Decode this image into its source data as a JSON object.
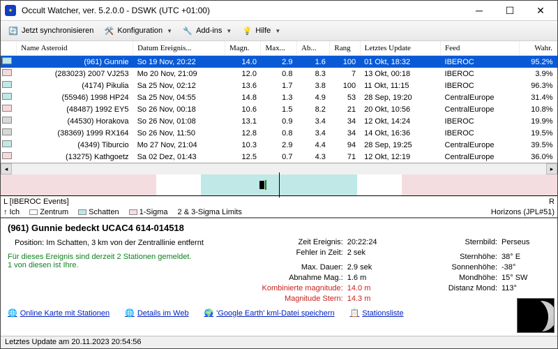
{
  "title": "Occult Watcher, ver. 5.2.0.0 - DSWK (UTC +01:00)",
  "toolbar": {
    "sync": "Jetzt synchronisieren",
    "config": "Konfiguration",
    "addins": "Add-ins",
    "help": "Hilfe"
  },
  "columns": {
    "name": "Name Asteroid",
    "date": "Datum Ereignis...",
    "magn": "Magn.",
    "max": "Max...",
    "ab": "Ab...",
    "rang": "Rang",
    "last": "Letztes Update",
    "feed": "Feed",
    "wahr": "Wahr."
  },
  "rows": [
    {
      "color": "#bfe8e6",
      "name": "(961) Gunnie",
      "date": "So 19 Nov, 20:22",
      "magn": "14.0",
      "max": "2.9",
      "ab": "1.6",
      "rang": "100",
      "last": "01 Okt, 18:32",
      "feed": "IBEROC",
      "wahr": "95.2%",
      "sel": true
    },
    {
      "color": "#f8d8dc",
      "name": "(283023) 2007 VJ253",
      "date": "Mo 20 Nov, 21:09",
      "magn": "12.0",
      "max": "0.8",
      "ab": "8.3",
      "rang": "7",
      "last": "13 Okt, 00:18",
      "feed": "IBEROC",
      "wahr": "3.9%"
    },
    {
      "color": "#bfe8e6",
      "name": "(4174) Pikulia",
      "date": "Sa 25 Nov, 02:12",
      "magn": "13.6",
      "max": "1.7",
      "ab": "3.8",
      "rang": "100",
      "last": "11 Okt, 11:15",
      "feed": "IBEROC",
      "wahr": "96.3%"
    },
    {
      "color": "#bfe8e6",
      "name": "(55946) 1998 HP24",
      "date": "Sa 25 Nov, 04:55",
      "magn": "14.8",
      "max": "1.3",
      "ab": "4.9",
      "rang": "53",
      "last": "28 Sep, 19:20",
      "feed": "CentralEurope",
      "wahr": "31.4%"
    },
    {
      "color": "#f8d8dc",
      "name": "(48487) 1992 EY5",
      "date": "So 26 Nov, 00:18",
      "magn": "10.6",
      "max": "1.5",
      "ab": "8.2",
      "rang": "21",
      "last": "20 Okt, 10:56",
      "feed": "CentralEurope",
      "wahr": "10.8%"
    },
    {
      "color": "#d8d8d8",
      "name": "(44530) Horakova",
      "date": "So 26 Nov, 01:08",
      "magn": "13.1",
      "max": "0.9",
      "ab": "3.4",
      "rang": "34",
      "last": "12 Okt, 14:24",
      "feed": "IBEROC",
      "wahr": "19.9%"
    },
    {
      "color": "#d8d8d8",
      "name": "(38369) 1999 RX164",
      "date": "So 26 Nov, 11:50",
      "magn": "12.8",
      "max": "0.8",
      "ab": "3.4",
      "rang": "34",
      "last": "14 Okt, 16:36",
      "feed": "IBEROC",
      "wahr": "19.5%"
    },
    {
      "color": "#bfe8e6",
      "name": "(4349) Tiburcio",
      "date": "Mo 27 Nov, 21:04",
      "magn": "10.3",
      "max": "2.9",
      "ab": "4.4",
      "rang": "94",
      "last": "28 Sep, 19:25",
      "feed": "CentralEurope",
      "wahr": "39.5%"
    },
    {
      "color": "#f8d8dc",
      "name": "(13275) Kathgoetz",
      "date": "Sa 02 Dez, 01:43",
      "magn": "12.5",
      "max": "0.7",
      "ab": "4.3",
      "rang": "71",
      "last": "12 Okt, 12:19",
      "feed": "CentralEurope",
      "wahr": "36.0%"
    }
  ],
  "topline": {
    "left": "L [IBEROC Events]",
    "right": "R"
  },
  "legend": {
    "ich": "Ich",
    "zentrum": "Zentrum",
    "schatten": "Schatten",
    "sigma1": "1-Sigma",
    "sigma23": "2 & 3-Sigma Limits",
    "horizons": "Horizons (JPL#51)"
  },
  "event": {
    "title": "(961) Gunnie bedeckt UCAC4 614-014518",
    "position_label": "Position:",
    "position": "Im Schatten, 3 km von der Zentrallinie entfernt",
    "stations1": "Für dieses Ereignis sind derzeit 2 Stationen gemeldet.",
    "stations2": "1 von diesen ist Ihre.",
    "time_label": "Zeit Ereignis:",
    "time": "20:22:24",
    "err_label": "Fehler in Zeit:",
    "err": "2 sek",
    "maxd_label": "Max. Dauer:",
    "maxd": "2.9 sek",
    "abn_label": "Abnahme Mag.:",
    "abn": "1.6 m",
    "komb_label": "Kombinierte magnitude:",
    "komb": "14.0 m",
    "mags_label": "Magnitude Stern:",
    "mags": "14.3 m",
    "const_label": "Sternbild:",
    "const": "Perseus",
    "alt_label": "Sternhöhe:",
    "alt": "38° E",
    "sun_label": "Sonnenhöhe:",
    "sun": "-38°",
    "moon_label": "Mondhöhe:",
    "moon": "15° SW",
    "dist_label": "Distanz Mond:",
    "dist": "113°"
  },
  "links": {
    "map": "Online Karte mit Stationen",
    "details": "Details im Web",
    "kml": "'Google Earth' kml-Datei speichern",
    "stations": "Stationsliste"
  },
  "status": "Letztes Update am 20.11.2023 20:54:56"
}
